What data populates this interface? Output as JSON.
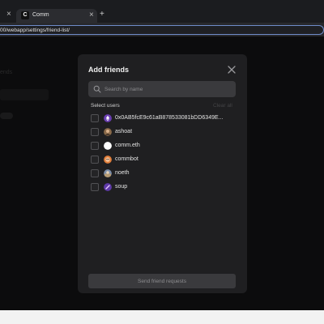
{
  "browser": {
    "tabs": [
      {
        "label": "",
        "favicon": ""
      },
      {
        "label": "Comm",
        "favicon": "C"
      }
    ],
    "new_tab_glyph": "+",
    "close_glyph": "×",
    "url": "00/webapp/settings/friend-list/"
  },
  "background": {
    "label": "ends"
  },
  "modal": {
    "title": "Add friends",
    "search_placeholder": "Search by name",
    "select_label": "Select users",
    "clear_all": "Clear all",
    "users": [
      {
        "name": "0x0AB5fcE9c61aB878533081bDD6349E...",
        "avatar_color": "#6b3fb3",
        "avatar_icon": "ethereum-icon"
      },
      {
        "name": "ashoat",
        "avatar_color": "#8a6a4a",
        "avatar_icon": "photo-avatar"
      },
      {
        "name": "comm.eth",
        "avatar_color": "#ffffff",
        "avatar_icon": "blank-avatar"
      },
      {
        "name": "commbot",
        "avatar_color": "#e07d3a",
        "avatar_icon": "bot-avatar"
      },
      {
        "name": "noeth",
        "avatar_color": "#7a8ca8",
        "avatar_icon": "photo-avatar"
      },
      {
        "name": "soup",
        "avatar_color": "#5e3aa8",
        "avatar_icon": "photo-avatar"
      }
    ],
    "send_label": "Send friend requests"
  },
  "colors": {
    "modal_bg": "#1f1f21",
    "accent_url_border": "#6f8cc9"
  }
}
